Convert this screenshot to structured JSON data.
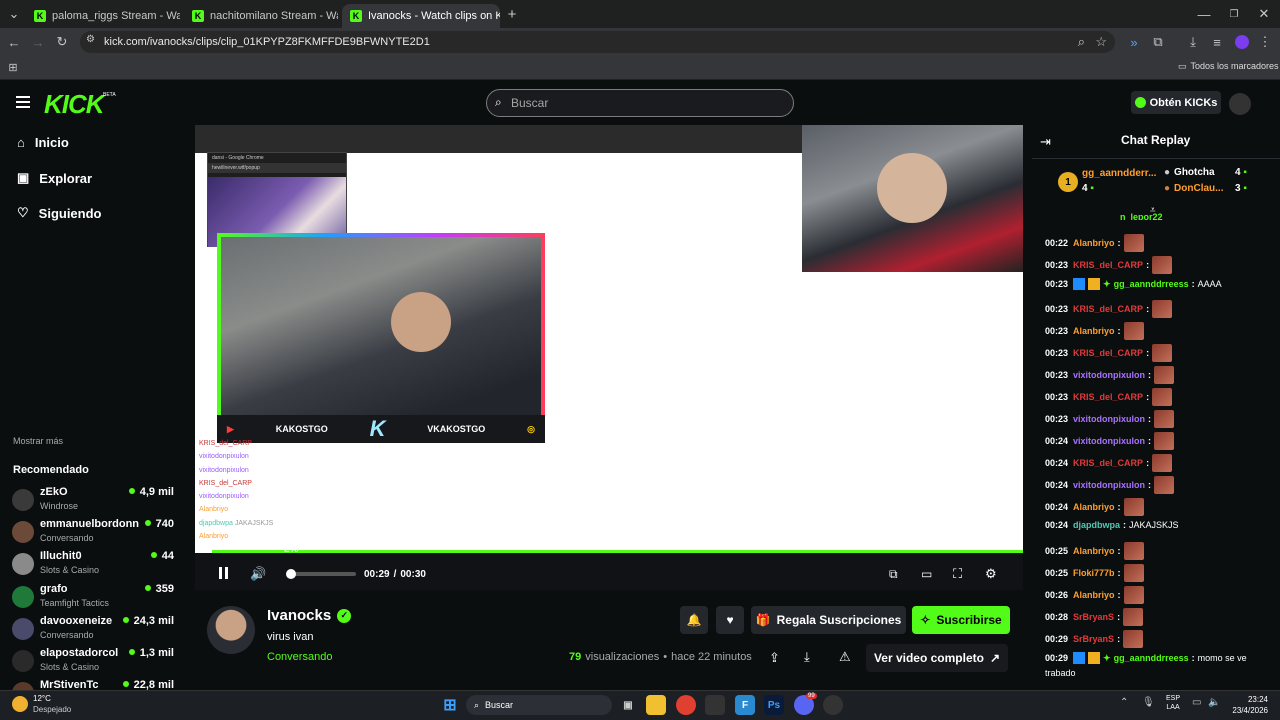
{
  "browser": {
    "tabs": [
      {
        "label": "paloma_riggs Stream - Watch L"
      },
      {
        "label": "nachitomilano Stream - Watch"
      },
      {
        "label": "Ivanocks - Watch clips on K"
      }
    ],
    "url": "kick.com/ivanocks/clips/clip_01KPYPZ8FKMFFDE9BFWNYTE2D1",
    "bookmarks_label": "Todos los marcadores"
  },
  "header": {
    "logo": "KICK",
    "beta": "BETA",
    "search_placeholder": "Buscar",
    "kicks_button": "Obtén KICKs"
  },
  "sidebar": {
    "nav": [
      {
        "label": "Inicio",
        "icon": "home-icon"
      },
      {
        "label": "Explorar",
        "icon": "compass-icon"
      },
      {
        "label": "Siguiendo",
        "icon": "heart-icon"
      }
    ],
    "show_more": "Mostrar más",
    "recommended_title": "Recomendado",
    "recommended": [
      {
        "name": "zEkO",
        "category": "Windrose",
        "viewers": "4,9 mil",
        "color": "#3a3a3a"
      },
      {
        "name": "emmanuelbordonn",
        "category": "Conversando",
        "viewers": "740",
        "color": "#6b4a3a"
      },
      {
        "name": "Illuchit0",
        "category": "Slots & Casino",
        "viewers": "44",
        "color": "#8a8a8a"
      },
      {
        "name": "grafo",
        "category": "Teamfight Tactics",
        "viewers": "359",
        "color": "#1f7a3a"
      },
      {
        "name": "davooxeneize",
        "category": "Conversando",
        "viewers": "24,3 mil",
        "color": "#4a4a6a"
      },
      {
        "name": "elapostadorcol",
        "category": "Slots & Casino",
        "viewers": "1,3 mil",
        "color": "#2a2a2a"
      },
      {
        "name": "MrStivenTc",
        "category": "",
        "viewers": "22,8 mil",
        "color": "#5a3a2a"
      }
    ]
  },
  "video": {
    "overlay_left": "KAKOSTGO",
    "overlay_right": "VKAKOSTGO",
    "inner_window_title": "dansi - Google Chrome",
    "inner_url": "hewillnever.wtf/popup",
    "progress_label": "2%",
    "progress_value": 0.02,
    "time_current": "00:29",
    "time_separator": "/",
    "time_total": "00:30",
    "mini_chat": [
      {
        "user": "KRIS_del_CARP",
        "color": "#c83a3a"
      },
      {
        "user": "vixitodonpixulon",
        "color": "#9b5cff"
      },
      {
        "user": "vixitodonpixulon",
        "color": "#9b5cff"
      },
      {
        "user": "KRIS_del_CARP",
        "color": "#c83a3a"
      },
      {
        "user": "vixitodonpixulon",
        "color": "#9b5cff"
      },
      {
        "user": "Alanbriyo",
        "color": "#ff9f2e"
      },
      {
        "user": "djapdbwpa",
        "color": "#53c8b4",
        "msg": "JAKAJSKJS"
      },
      {
        "user": "Alanbriyo",
        "color": "#ff9f2e"
      }
    ]
  },
  "info": {
    "channel": "Ivanocks",
    "title": "virus ivan",
    "category": "Conversando",
    "views_count": "79",
    "views_label": "visualizaciones",
    "dot": "•",
    "ago": "hace 22 minutos",
    "gift_button": "Regala Suscripciones",
    "subscribe_button": "Suscribirse",
    "full_video_button": "Ver video completo"
  },
  "chat": {
    "title": "Chat Replay",
    "leaderboard": [
      {
        "rank": "1",
        "name": "gg_aanndderr...",
        "count": "4"
      },
      {
        "name": "Ghotcha",
        "count": "4"
      },
      {
        "name": "DonClau...",
        "count": "3"
      }
    ],
    "top_partial": "n_lepor22",
    "lines": [
      {
        "t": "00:22",
        "user": "Alanbriyo",
        "color": "#ff9f2e",
        "msg": "",
        "emote": true
      },
      {
        "t": "00:23",
        "user": "KRIS_del_CARP",
        "color": "#e23a3a",
        "msg": "",
        "emote": true
      },
      {
        "t": "00:23",
        "user": "gg_aannddrreess",
        "color": "#53fc18",
        "msg": "AAAA",
        "emote": false,
        "badges": true
      },
      {
        "t": "00:23",
        "user": "KRIS_del_CARP",
        "color": "#e23a3a",
        "msg": "",
        "emote": true
      },
      {
        "t": "00:23",
        "user": "Alanbriyo",
        "color": "#ff9f2e",
        "msg": "",
        "emote": true
      },
      {
        "t": "00:23",
        "user": "KRIS_del_CARP",
        "color": "#e23a3a",
        "msg": "",
        "emote": true
      },
      {
        "t": "00:23",
        "user": "vixitodonpixulon",
        "color": "#a970ff",
        "msg": "",
        "emote": true
      },
      {
        "t": "00:23",
        "user": "KRIS_del_CARP",
        "color": "#e23a3a",
        "msg": "",
        "emote": true
      },
      {
        "t": "00:23",
        "user": "vixitodonpixulon",
        "color": "#a970ff",
        "msg": "",
        "emote": true
      },
      {
        "t": "00:24",
        "user": "vixitodonpixulon",
        "color": "#a970ff",
        "msg": "",
        "emote": true
      },
      {
        "t": "00:24",
        "user": "KRIS_del_CARP",
        "color": "#e23a3a",
        "msg": "",
        "emote": true
      },
      {
        "t": "00:24",
        "user": "vixitodonpixulon",
        "color": "#a970ff",
        "msg": "",
        "emote": true
      },
      {
        "t": "00:24",
        "user": "Alanbriyo",
        "color": "#ff9f2e",
        "msg": "",
        "emote": true
      },
      {
        "t": "00:24",
        "user": "djapdbwpa",
        "color": "#53c8b4",
        "msg": "JAKAJSKJS",
        "emote": false
      },
      {
        "t": "00:25",
        "user": "Alanbriyo",
        "color": "#ff9f2e",
        "msg": "",
        "emote": true
      },
      {
        "t": "00:25",
        "user": "Floki777b",
        "color": "#ff9f2e",
        "msg": "",
        "emote": true
      },
      {
        "t": "00:26",
        "user": "Alanbriyo",
        "color": "#ff9f2e",
        "msg": "",
        "emote": true
      },
      {
        "t": "00:28",
        "user": "SrBryanS",
        "color": "#e23a3a",
        "msg": "",
        "emote": true
      },
      {
        "t": "00:29",
        "user": "SrBryanS",
        "color": "#e23a3a",
        "msg": "",
        "emote": true
      }
    ],
    "last_line": {
      "t": "00:29",
      "user": "gg_aannddrreess",
      "color": "#53fc18",
      "msg": "momo se ve",
      "msg2": "trabado"
    }
  },
  "taskbar": {
    "weather_temp": "12°C",
    "weather_desc": "Despejado",
    "search": "Buscar",
    "lang1": "ESP",
    "lang2": "LAA",
    "time": "23:24",
    "date": "23/4/2026",
    "notif_count": "99"
  }
}
